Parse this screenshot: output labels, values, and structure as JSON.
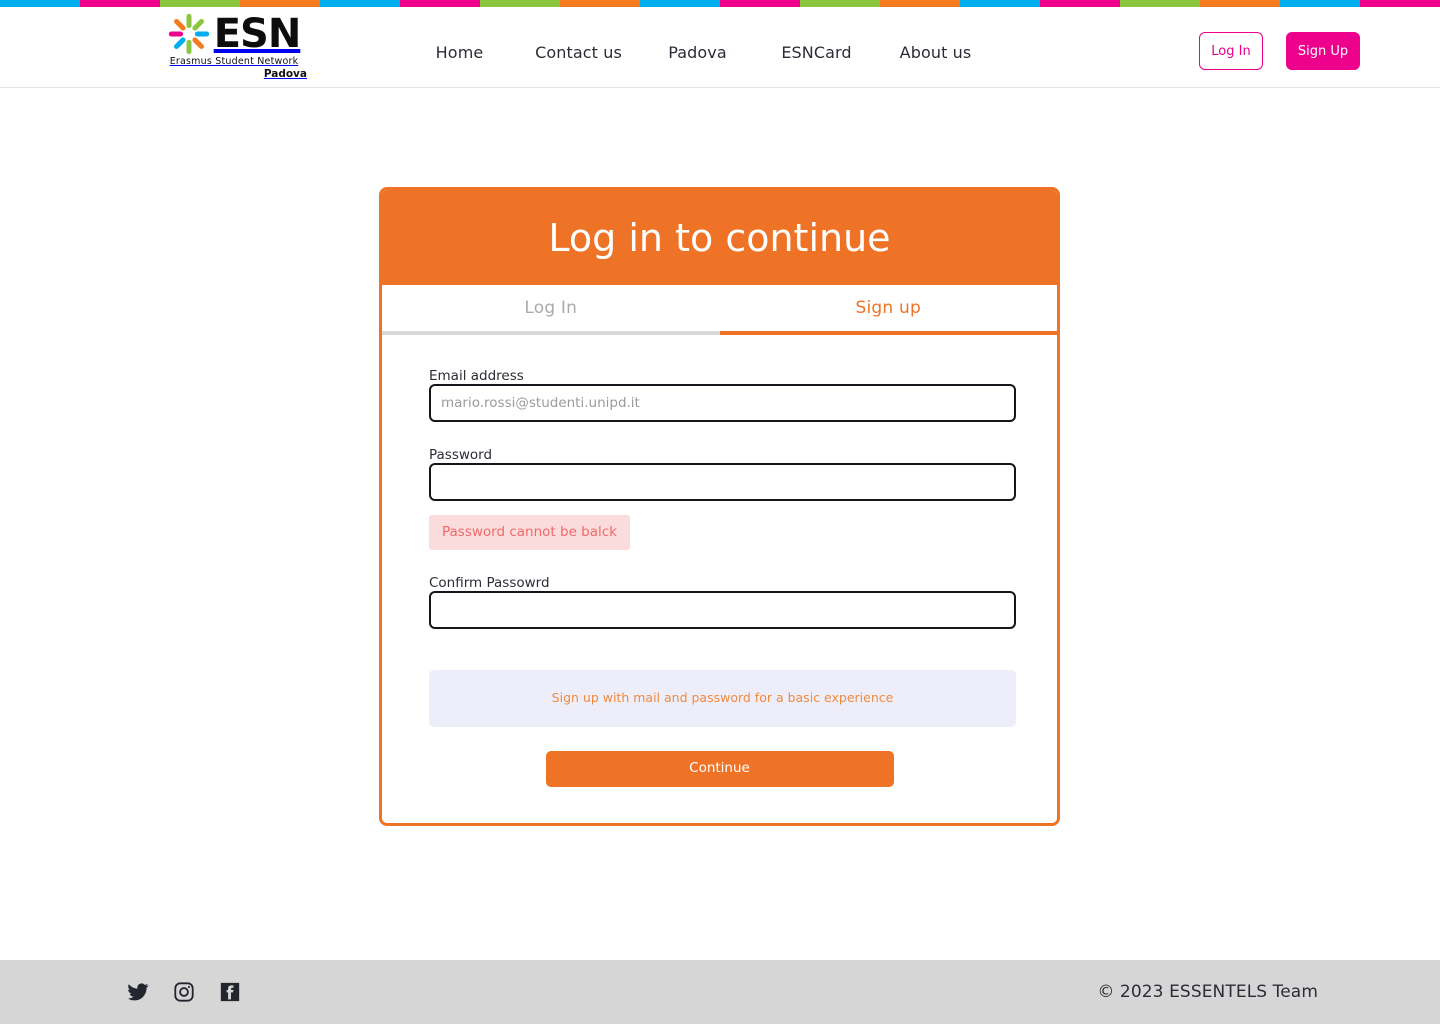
{
  "brand": {
    "logo_word": "ESN",
    "logo_subtitle": "Erasmus Student Network",
    "logo_city": "Padova",
    "star_colors": [
      "#ec008c",
      "#f47b20",
      "#f9c10a",
      "#8cc63e",
      "#00adef",
      "#7e57c2",
      "#ec008c",
      "#00adef"
    ],
    "accent_orange": "#ee7326",
    "accent_magenta": "#ec008c"
  },
  "top_stripe": {
    "colors": [
      "#00adef",
      "#ec008c",
      "#8cc63e",
      "#f47b20"
    ],
    "block_width": 80,
    "repeat_count": 18
  },
  "header": {
    "nav": [
      {
        "label": "Home",
        "name": "nav-home"
      },
      {
        "label": "Contact us",
        "name": "nav-contact-us"
      },
      {
        "label": "Padova",
        "name": "nav-padova"
      },
      {
        "label": "ESNCard",
        "name": "nav-esncard"
      },
      {
        "label": "About us",
        "name": "nav-about-us"
      }
    ],
    "login_button": "Log In",
    "signup_button": "Sign Up"
  },
  "card": {
    "title": "Log in to continue",
    "tabs": [
      {
        "label": "Log In",
        "active": false
      },
      {
        "label": "Sign up",
        "active": true
      }
    ],
    "fields": {
      "email_label": "Email address",
      "email_placeholder": "mario.rossi@studenti.unipd.it",
      "email_value": "",
      "password_label": "Password",
      "password_value": "",
      "confirm_label": "Confirm Passowrd",
      "confirm_value": ""
    },
    "error_message": "Password cannot be balck",
    "info_message": "Sign up with mail and password for a basic experience",
    "submit_button": "Continue"
  },
  "footer": {
    "social": [
      {
        "name": "twitter-icon",
        "label": "Twitter"
      },
      {
        "name": "instagram-icon",
        "label": "Instagram"
      },
      {
        "name": "facebook-icon",
        "label": "Facebook"
      }
    ],
    "copyright": "© 2023 ESSENTELS Team"
  }
}
